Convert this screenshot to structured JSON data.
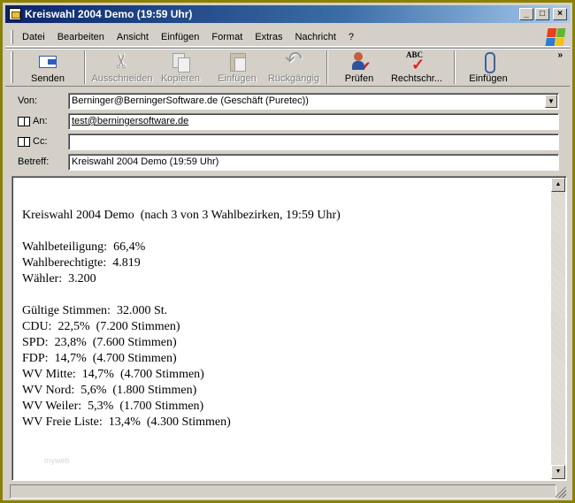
{
  "window": {
    "title": "Kreiswahl 2004 Demo (19:59 Uhr)",
    "controls": [
      "_",
      "□",
      "×"
    ]
  },
  "menu": {
    "items": [
      "Datei",
      "Bearbeiten",
      "Ansicht",
      "Einfügen",
      "Format",
      "Extras",
      "Nachricht",
      "?"
    ]
  },
  "toolbar": {
    "buttons": [
      {
        "label": "Senden",
        "icon": "send-icon",
        "enabled": true
      },
      {
        "label": "Ausschneiden",
        "icon": "scissors-icon",
        "enabled": false
      },
      {
        "label": "Kopieren",
        "icon": "copy-icon",
        "enabled": false
      },
      {
        "label": "Einfügen",
        "icon": "paste-icon",
        "enabled": false
      },
      {
        "label": "Rückgängig",
        "icon": "undo-icon",
        "enabled": false
      },
      {
        "label": "Prüfen",
        "icon": "check-names-icon",
        "enabled": true
      },
      {
        "label": "Rechtschr...",
        "icon": "spelling-icon",
        "enabled": true
      },
      {
        "label": "Einfügen",
        "icon": "attach-icon",
        "enabled": true
      }
    ],
    "more": "»"
  },
  "header": {
    "from_label": "Von:",
    "from_value": "Berninger@BerningerSoftware.de    (Geschäft (Puretec))",
    "to_label": "An:",
    "to_value": "test@berningersoftware.de",
    "cc_label": "Cc:",
    "cc_value": "",
    "subject_label": "Betreff:",
    "subject_value": "Kreiswahl 2004 Demo (19:59 Uhr)"
  },
  "body": {
    "heading": "Kreiswahl 2004 Demo  (nach 3 von 3 Wahlbezirken, 19:59 Uhr)",
    "turnout": "Wahlbeteiligung:  66,4%",
    "eligible": "Wahlberechtigte:  4.819",
    "voters": "Wähler:  3.200",
    "valid_votes": "Gültige Stimmen:  32.000 St.",
    "results": [
      "CDU:  22,5%  (7.200 Stimmen)",
      "SPD:  23,8%  (7.600 Stimmen)",
      "FDP:  14,7%  (4.700 Stimmen)",
      "WV Mitte:  14,7%  (4.700 Stimmen)",
      "WV Nord:  5,6%  (1.800 Stimmen)",
      "WV Weiler:  5,3%  (1.700 Stimmen)",
      "WV Freie Liste:  13,4%  (4.300 Stimmen)"
    ],
    "watermark": "myweb"
  }
}
